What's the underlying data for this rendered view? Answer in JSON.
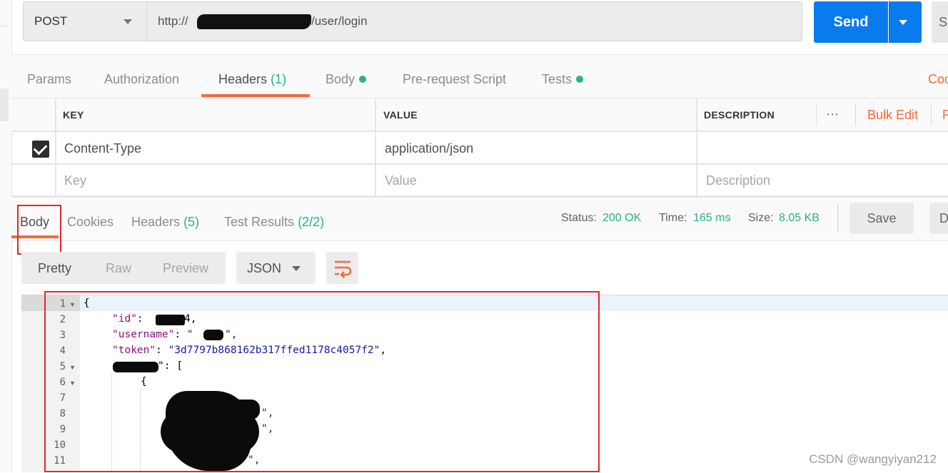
{
  "request": {
    "method": "POST",
    "url_prefix": "http://",
    "url_suffix": "/user/login",
    "send_label": "Send",
    "save_label_partial": "S"
  },
  "request_tabs": {
    "params": "Params",
    "authorization": "Authorization",
    "headers": "Headers",
    "headers_count": "(1)",
    "body": "Body",
    "prerequest": "Pre-request Script",
    "tests": "Tests",
    "code_partial": "Coo"
  },
  "headers_table": {
    "columns": {
      "key": "KEY",
      "value": "VALUE",
      "description": "DESCRIPTION"
    },
    "more_icon": "⋯",
    "bulk_edit": "Bulk Edit",
    "presets_partial": "P",
    "rows": [
      {
        "checked": true,
        "key": "Content-Type",
        "value": "application/json",
        "description": ""
      }
    ],
    "placeholders": {
      "key": "Key",
      "value": "Value",
      "description": "Description"
    }
  },
  "response_tabs": {
    "body": "Body",
    "cookies": "Cookies",
    "headers": "Headers",
    "headers_count": "(5)",
    "test_results": "Test Results",
    "test_results_count": "(2/2)"
  },
  "response_status": {
    "status_label": "Status:",
    "status_value": "200 OK",
    "time_label": "Time:",
    "time_value": "165 ms",
    "size_label": "Size:",
    "size_value": "8.05 KB",
    "save_label": "Save",
    "download_partial": "D"
  },
  "view_options": {
    "pretty": "Pretty",
    "raw": "Raw",
    "preview": "Preview",
    "format": "JSON"
  },
  "code_lines": {
    "l1": "{",
    "l2_key": "\"id\"",
    "l2_tail": "4,",
    "l3_key": "\"username\"",
    "l3_val": "\"",
    "l3_tail": "\",",
    "l4_key": "\"token\"",
    "l4_val": "\"3d7797b868162b317ffed1178c4057f2\"",
    "l5_tail": "\": [",
    "l6": "{",
    "l8_tail": "\",",
    "l9_tail": "\",",
    "l11_tail": "\","
  },
  "line_numbers": [
    "1",
    "2",
    "3",
    "4",
    "5",
    "6",
    "7",
    "8",
    "9",
    "10",
    "11"
  ],
  "watermark": "CSDN @wangyiyan212",
  "colors": {
    "accent_orange": "#f26b3a",
    "send_blue": "#097bed",
    "success_green": "#26b47f",
    "annotation_red": "#e4262c"
  }
}
